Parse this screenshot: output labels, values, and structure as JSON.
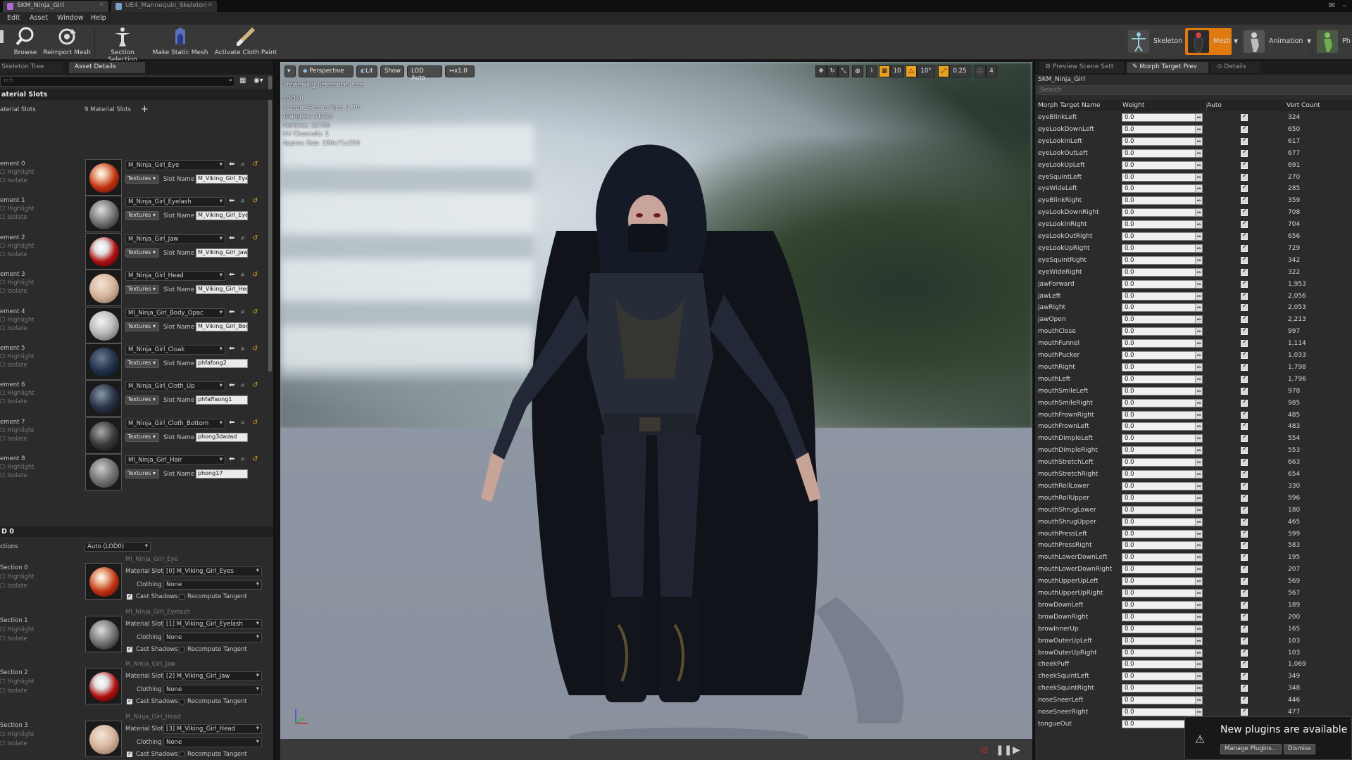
{
  "window": {
    "tabs": [
      {
        "label": "SKM_Ninja_Girl"
      },
      {
        "label": "UE4_Mannequin_Skeleton"
      }
    ]
  },
  "menu": [
    "Edit",
    "Asset",
    "Window",
    "Help"
  ],
  "toolbar": {
    "buttons": [
      {
        "label": "Browse",
        "icon": "magnifier-icon"
      },
      {
        "label": "Reimport Mesh",
        "icon": "reimport-icon"
      },
      {
        "label": "Section Selection",
        "icon": "section-selection-icon"
      },
      {
        "label": "Make Static Mesh",
        "icon": "static-mesh-icon"
      },
      {
        "label": "Activate Cloth Paint",
        "icon": "brush-icon"
      }
    ],
    "modes": [
      {
        "label": "Skeleton"
      },
      {
        "label": "Mesh"
      },
      {
        "label": "Animation"
      },
      {
        "label": "Ph"
      }
    ]
  },
  "left_panel": {
    "tabs": [
      "Skeleton Tree",
      "Asset Details"
    ],
    "search_placeholder": "rch",
    "material_slots_header": "aterial Slots",
    "material_slots_label": "aterial Slots",
    "material_slots_count": "9 Material Slots",
    "highlight_label": "Highlight",
    "isolate_label": "Isolate",
    "textures_label": "Textures",
    "slot_name_label": "Slot Name",
    "elements": [
      {
        "label": "ement 0",
        "material": "M_Ninja_Girl_Eye",
        "slot": "M_Viking_Girl_Eye"
      },
      {
        "label": "ement 1",
        "material": "M_Ninja_Girl_Eyelash",
        "slot": "M_Viking_Girl_Eye"
      },
      {
        "label": "ement 2",
        "material": "M_Ninja_Girl_Jaw",
        "slot": "M_Viking_Girl_Jaw"
      },
      {
        "label": "ement 3",
        "material": "M_Ninja_Girl_Head",
        "slot": "M_Viking_Girl_Hea"
      },
      {
        "label": "ement 4",
        "material": "MI_Ninja_Girl_Body_Opac",
        "slot": "M_Viking_Girl_Boc"
      },
      {
        "label": "ement 5",
        "material": "M_Ninja_Girl_Cloak",
        "slot": "phfafong2"
      },
      {
        "label": "ement 6",
        "material": "M_Ninja_Girl_Cloth_Up",
        "slot": "phfaffaong1"
      },
      {
        "label": "ement 7",
        "material": "M_Ninja_Girl_Cloth_Bottom",
        "slot": "phong3dadad"
      },
      {
        "label": "ement 8",
        "material": "MI_Ninja_Girl_Hair",
        "slot": "phong17"
      }
    ],
    "lod_header": "D 0",
    "sections_label": "ctions",
    "lod_value": "Auto (LOD0)",
    "material_slot_label": "Material Slot",
    "clothing_label": "Clothing",
    "clothing_value": "None",
    "cast_shadows_label": "Cast Shadows",
    "recompute_tangent_label": "Recompute Tangent",
    "sections": [
      {
        "label": "Section 0",
        "material": "MI_Ninja_Girl_Eye",
        "slot": "[0] M_Viking_Girl_Eyes"
      },
      {
        "label": "Section 1",
        "material": "MI_Ninja_Girl_Eyelash",
        "slot": "[1] M_Viking_Girl_Eyelash"
      },
      {
        "label": "Section 2",
        "material": "M_Ninja_Girl_Jaw",
        "slot": "[2] M_Viking_Girl_Jaw"
      },
      {
        "label": "Section 3",
        "material": "M_Ninja_Girl_Head",
        "slot": "[3] M_Viking_Girl_Head"
      }
    ]
  },
  "viewport": {
    "buttons": [
      "Perspective",
      "Lit",
      "Show",
      "LOD Auto",
      "x1.0"
    ],
    "info": [
      "Previewing Reference Pose",
      "LOD: 0",
      "Current Screen Size: 1.70",
      "Triangles: 51513",
      "Vertices: 32700",
      "UV Channels: 1",
      "Approx Size: 190x71x259"
    ],
    "grid_snap": "10",
    "rotation_snap": "10°",
    "scale_snap": "0.25",
    "camera_speed": "4"
  },
  "right_panel": {
    "tabs": [
      "Preview Scene Sett",
      "Morph Target Prev",
      "Details"
    ],
    "mesh_name": "SKM_Ninja_Girl",
    "search_placeholder": "Search",
    "columns": [
      "Morph Target Name",
      "Weight",
      "Auto",
      "Vert Count"
    ],
    "weight_value": "0.0",
    "morph_targets": [
      {
        "name": "eyeBlinkLeft",
        "count": "324"
      },
      {
        "name": "eyeLookDownLeft",
        "count": "650"
      },
      {
        "name": "eyeLookInLeft",
        "count": "617"
      },
      {
        "name": "eyeLookOutLeft",
        "count": "677"
      },
      {
        "name": "eyeLookUpLeft",
        "count": "691"
      },
      {
        "name": "eyeSquintLeft",
        "count": "270"
      },
      {
        "name": "eyeWideLeft",
        "count": "285"
      },
      {
        "name": "eyeBlinkRight",
        "count": "359"
      },
      {
        "name": "eyeLookDownRight",
        "count": "708"
      },
      {
        "name": "eyeLookInRight",
        "count": "704"
      },
      {
        "name": "eyeLookOutRight",
        "count": "656"
      },
      {
        "name": "eyeLookUpRight",
        "count": "729"
      },
      {
        "name": "eyeSquintRight",
        "count": "342"
      },
      {
        "name": "eyeWideRight",
        "count": "322"
      },
      {
        "name": "jawForward",
        "count": "1,953"
      },
      {
        "name": "jawLeft",
        "count": "2,056"
      },
      {
        "name": "jawRight",
        "count": "2,053"
      },
      {
        "name": "jawOpen",
        "count": "2,213"
      },
      {
        "name": "mouthClose",
        "count": "997"
      },
      {
        "name": "mouthFunnel",
        "count": "1,114"
      },
      {
        "name": "mouthPucker",
        "count": "1,033"
      },
      {
        "name": "mouthRight",
        "count": "1,798"
      },
      {
        "name": "mouthLeft",
        "count": "1,796"
      },
      {
        "name": "mouthSmileLeft",
        "count": "978"
      },
      {
        "name": "mouthSmileRight",
        "count": "985"
      },
      {
        "name": "mouthFrownRight",
        "count": "485"
      },
      {
        "name": "mouthFrownLeft",
        "count": "483"
      },
      {
        "name": "mouthDimpleLeft",
        "count": "554"
      },
      {
        "name": "mouthDimpleRight",
        "count": "553"
      },
      {
        "name": "mouthStretchLeft",
        "count": "663"
      },
      {
        "name": "mouthStretchRight",
        "count": "654"
      },
      {
        "name": "mouthRollLower",
        "count": "330"
      },
      {
        "name": "mouthRollUpper",
        "count": "596"
      },
      {
        "name": "mouthShrugLower",
        "count": "180"
      },
      {
        "name": "mouthShrugUpper",
        "count": "465"
      },
      {
        "name": "mouthPressLeft",
        "count": "599"
      },
      {
        "name": "mouthPressRight",
        "count": "583"
      },
      {
        "name": "mouthLowerDownLeft",
        "count": "195"
      },
      {
        "name": "mouthLowerDownRight",
        "count": "207"
      },
      {
        "name": "mouthUpperUpLeft",
        "count": "569"
      },
      {
        "name": "mouthUpperUpRight",
        "count": "567"
      },
      {
        "name": "browDownLeft",
        "count": "189"
      },
      {
        "name": "browDownRight",
        "count": "200"
      },
      {
        "name": "browInnerUp",
        "count": "165"
      },
      {
        "name": "browOuterUpLeft",
        "count": "103"
      },
      {
        "name": "browOuterUpRight",
        "count": "103"
      },
      {
        "name": "cheekPuff",
        "count": "1,069"
      },
      {
        "name": "cheekSquintLeft",
        "count": "349"
      },
      {
        "name": "cheekSquintRight",
        "count": "348"
      },
      {
        "name": "noseSneerLeft",
        "count": "446"
      },
      {
        "name": "noseSneerRight",
        "count": "477"
      },
      {
        "name": "tongueOut",
        "count": ""
      }
    ]
  },
  "notification": {
    "text": "New plugins are available",
    "manage_label": "Manage Plugins...",
    "dismiss_label": "Dismiss"
  },
  "colors": {
    "accent": "#e8a020",
    "mesh_mode": "#e07a10"
  }
}
